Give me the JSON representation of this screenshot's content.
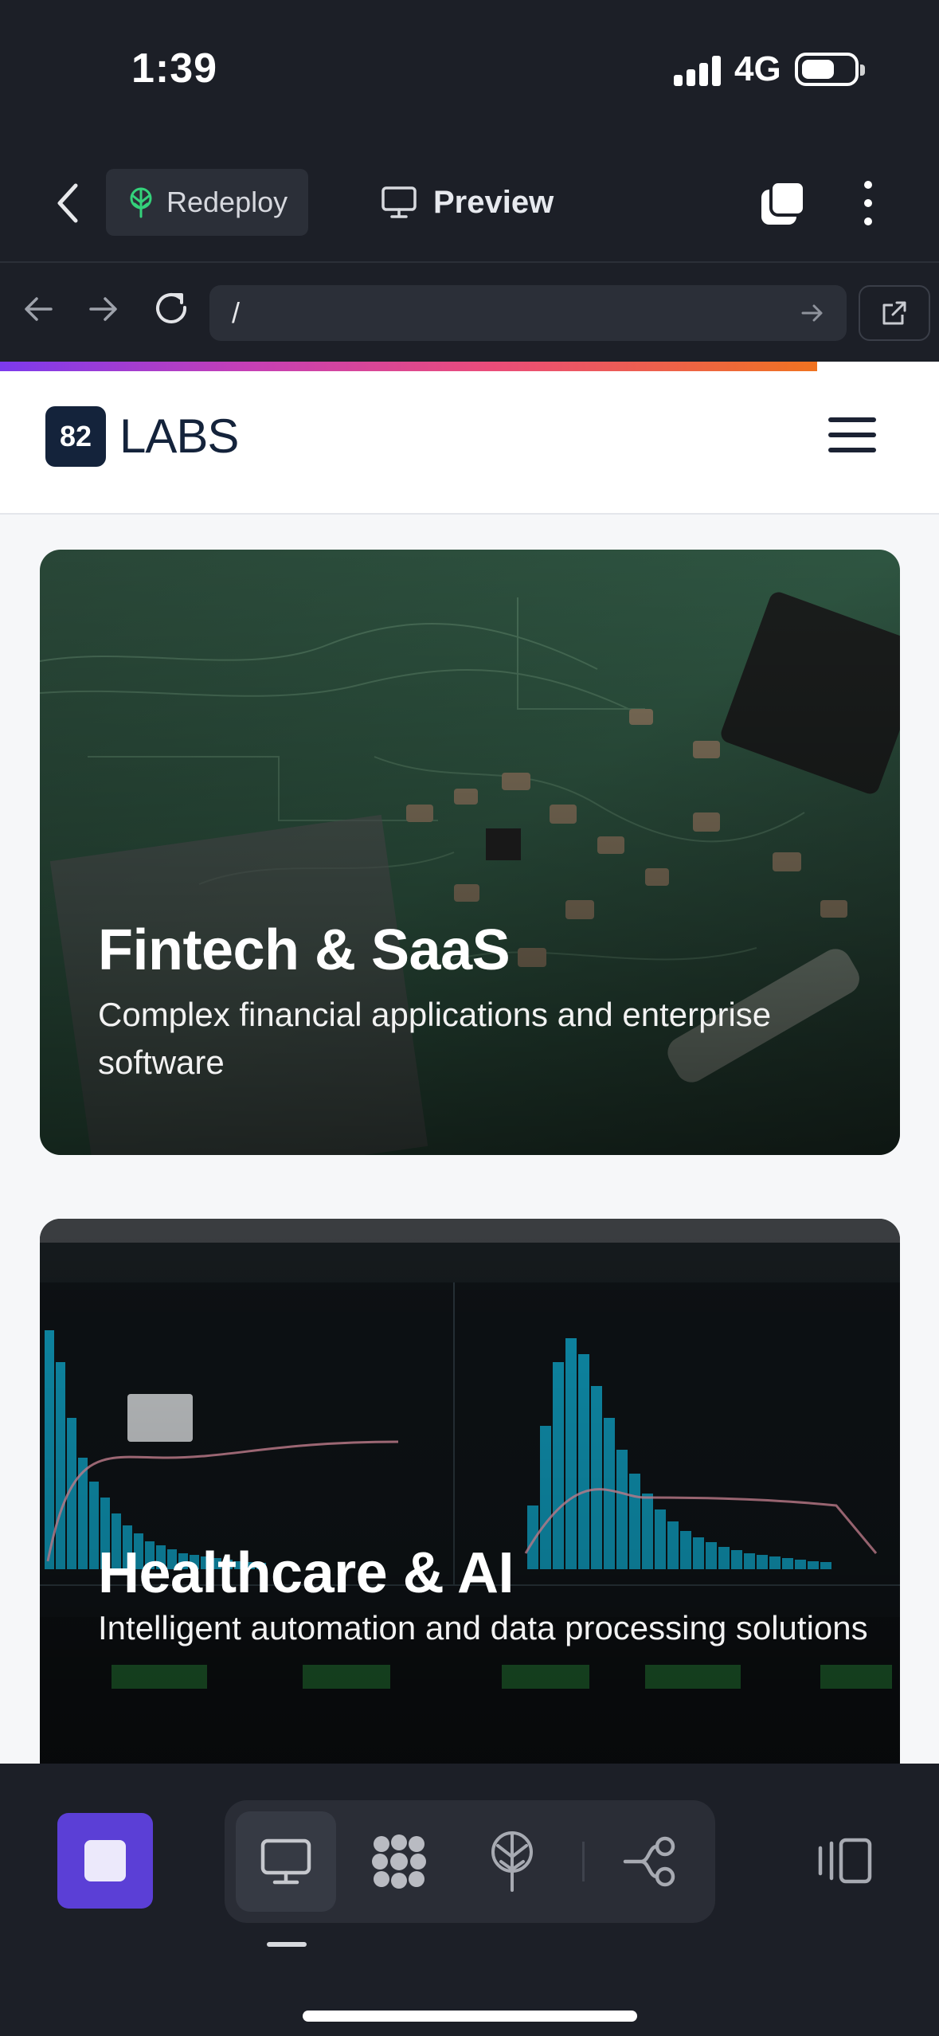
{
  "status_bar": {
    "time": "1:39",
    "network": "4G"
  },
  "header": {
    "redeploy_label": "Redeploy",
    "preview_label": "Preview"
  },
  "url_bar": {
    "url": "/"
  },
  "progress": {
    "fraction": 0.87,
    "gradient_colors": [
      "#7c3aed",
      "#ea4c7a",
      "#f07320"
    ]
  },
  "site": {
    "logo_badge": "82",
    "logo_text": "LABS",
    "cards": [
      {
        "title": "Fintech & SaaS",
        "description": "Complex financial applications and enterprise software"
      },
      {
        "title": "Healthcare & AI",
        "description": "Intelligent automation and data processing solutions"
      }
    ]
  },
  "toolbar": {
    "icons": [
      "stop-icon",
      "desktop-icon",
      "apps-icon",
      "deploy-icon",
      "workflow-icon",
      "panel-icon"
    ],
    "accent_color": "#5b3fd6"
  }
}
